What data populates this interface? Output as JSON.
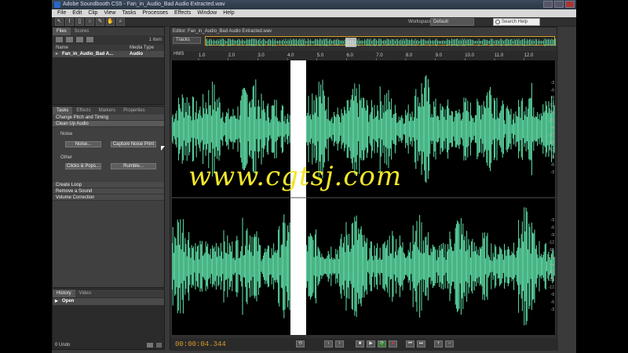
{
  "window": {
    "title": "Adobe Soundbooth CS5 - Fan_in_Audio_Bad Audio Extracted.wav"
  },
  "menu": [
    "File",
    "Edit",
    "Clip",
    "View",
    "Tasks",
    "Processes",
    "Effects",
    "Window",
    "Help"
  ],
  "toolbar": {
    "workspace_label": "Workspace:",
    "workspace_value": "Default",
    "search_placeholder": "Search Help"
  },
  "files_panel": {
    "tabs": [
      "Files",
      "Scores"
    ],
    "item_count": "1 item",
    "col_name": "Name",
    "col_media": "Media Type",
    "row_name": "Fan_in_Audio_Bad A...",
    "row_media": "Audio"
  },
  "tasks_panel": {
    "tabs": [
      "Tasks",
      "Effects",
      "Markers",
      "Properties"
    ],
    "change_pitch": "Change Pitch and Timing",
    "clean_up": "Clean Up Audio",
    "noise_label": "Noise",
    "noise_btn": "Noise...",
    "capture_btn": "Capture Noise Print",
    "other_label": "Other",
    "clicks_btn": "Clicks & Pops...",
    "rumble_btn": "Rumble...",
    "create_loop": "Create Loop",
    "remove_sound": "Remove a Sound",
    "volume_correction": "Volume Correction"
  },
  "history_panel": {
    "tabs": [
      "History",
      "Video"
    ],
    "open": "Open",
    "undos": "0 Undo"
  },
  "editor": {
    "title": "Editor: Fan_in_Audio_Bad Audio Extracted.wav",
    "tracks": "Tracks",
    "ruler_unit": "HMS",
    "ruler_ticks": [
      "1.0",
      "2.0",
      "3.0",
      "4.0",
      "5.0",
      "6.0",
      "7.0",
      "8.0",
      "9.0",
      "10.0",
      "11.0",
      "12.0"
    ],
    "volume_unit": "dB",
    "db_labels": [
      "-3",
      "-6",
      "-9",
      "-12",
      "-15",
      "-21",
      "-∞",
      "-21",
      "-15",
      "-12",
      "-9",
      "-6",
      "-3"
    ],
    "timecode": "00:00:04.344",
    "waveform_color": "#5fe0a8"
  },
  "watermark": "www.cgtsj.com"
}
